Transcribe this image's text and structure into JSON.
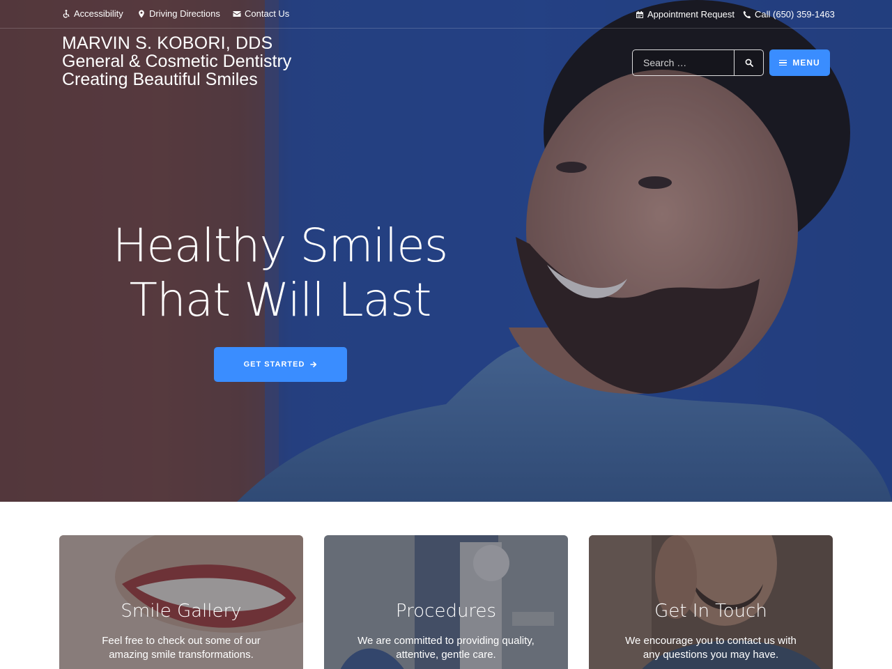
{
  "utility_bar": {
    "accessibility": "Accessibility",
    "driving_directions": "Driving Directions",
    "contact_us": "Contact Us",
    "appointment_request": "Appointment Request",
    "call": "Call (650) 359-1463"
  },
  "brand": {
    "line1": "MARVIN S. KOBORI, DDS",
    "line2": "General & Cosmetic Dentistry",
    "line3": "Creating Beautiful Smiles"
  },
  "search": {
    "placeholder": "Search …"
  },
  "menu": {
    "label": "MENU"
  },
  "hero": {
    "headline_line1": "Healthy Smiles",
    "headline_line2": "That Will Last",
    "cta_label": "GET STARTED"
  },
  "cards": [
    {
      "title": "Smile Gallery",
      "text": "Feel free to check out some of our amazing smile transformations."
    },
    {
      "title": "Procedures",
      "text": "We are committed to providing quality, attentive, gentle care."
    },
    {
      "title": "Get In Touch",
      "text": "We encourage you to contact us with any questions you may have."
    }
  ],
  "colors": {
    "accent": "#3a8dff",
    "hero_blue": "#2d54a8"
  },
  "icons": {
    "accessibility": "wheelchair-icon",
    "directions": "map-marker-icon",
    "contact": "envelope-icon",
    "appointment": "calendar-icon",
    "call": "phone-icon",
    "search": "search-icon",
    "menu": "hamburger-icon",
    "cta": "arrow-right-icon"
  }
}
